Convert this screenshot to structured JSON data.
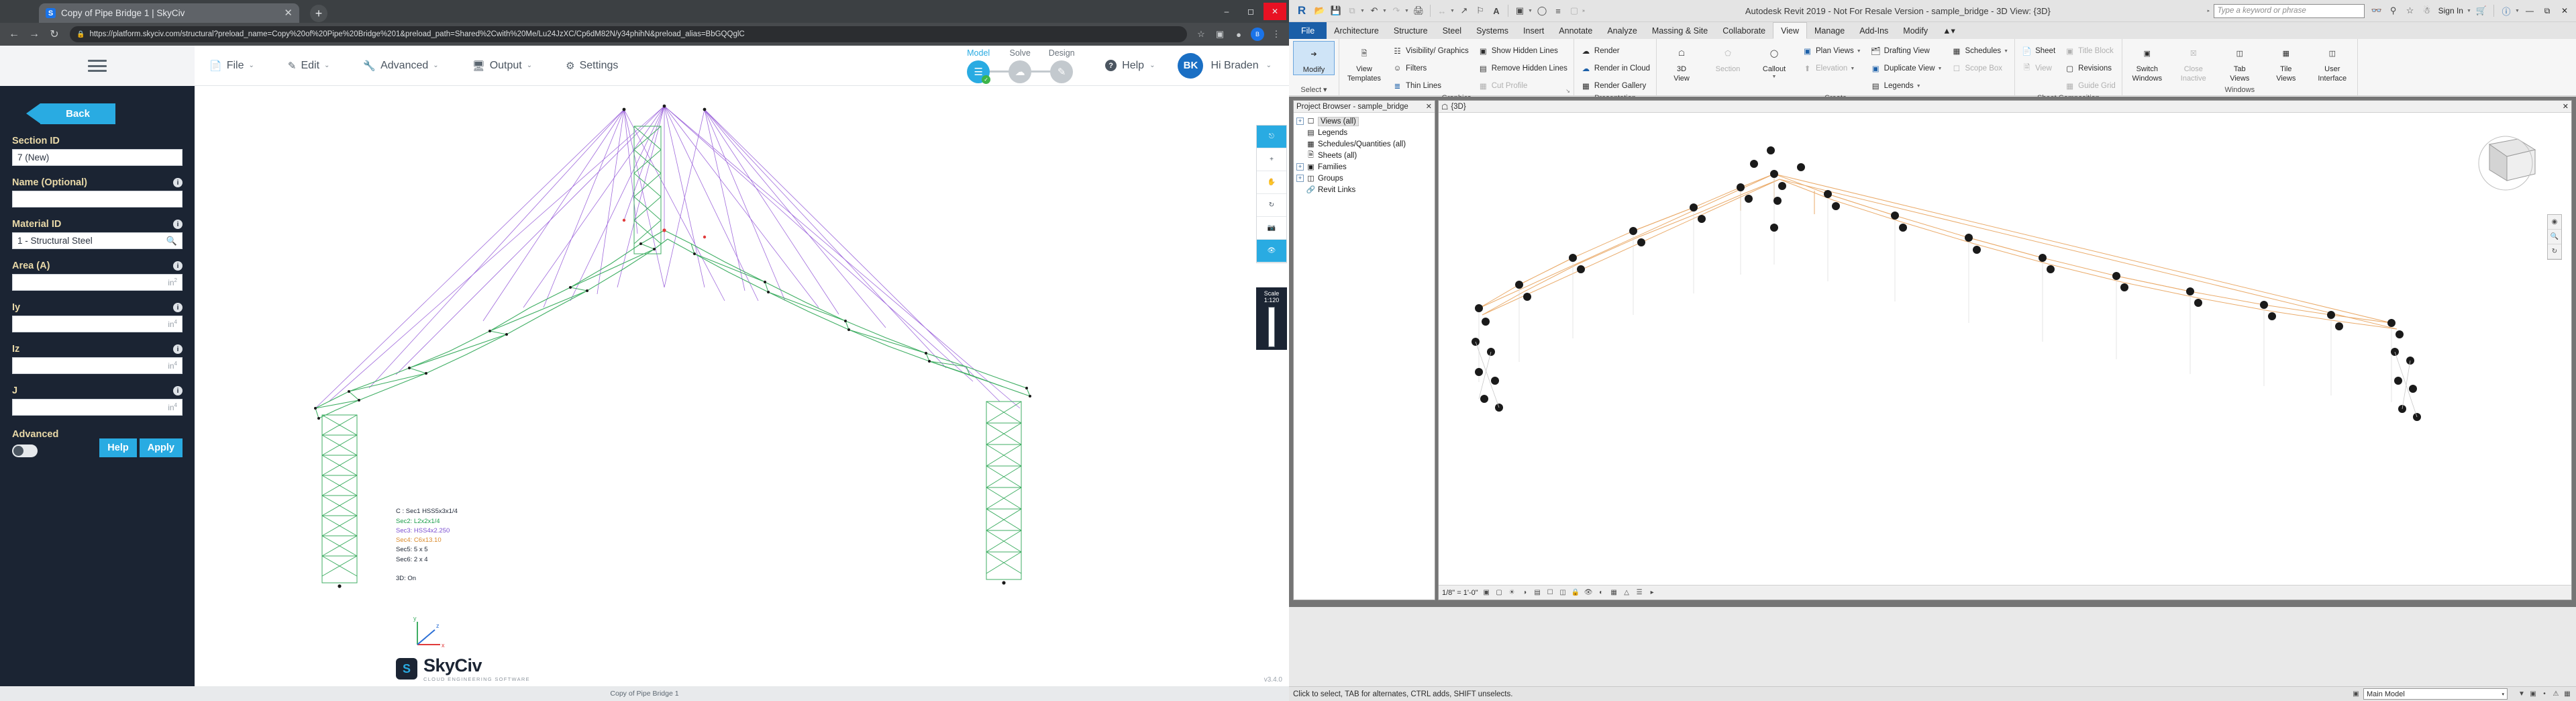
{
  "browser": {
    "tab": {
      "title": "Copy of Pipe Bridge 1 | SkyCiv",
      "favicon_letter": "S",
      "close": "✕"
    },
    "newtab_label": "+",
    "url": "https://platform.skyciv.com/structural?preload_name=Copy%20of%20Pipe%20Bridge%201&preload_path=Shared%2Cwith%20Me/Lu24JzXC/Cp6dM82N/y34phihN&preload_alias=BbGQQglC",
    "lock_icon": "lock-icon",
    "window_buttons": [
      "–",
      "❐",
      "✕"
    ]
  },
  "skyciv": {
    "menu": [
      {
        "label": "File",
        "icon": "file-icon",
        "caret": "⌄"
      },
      {
        "label": "Edit",
        "icon": "pencil-icon",
        "caret": "⌄"
      },
      {
        "label": "Advanced",
        "icon": "wrench-icon",
        "caret": "⌄"
      },
      {
        "label": "Output",
        "icon": "monitor-icon",
        "caret": "⌄"
      },
      {
        "label": "Settings",
        "icon": "gear-icon",
        "caret": ""
      }
    ],
    "stages": [
      {
        "label": "Model",
        "active": true,
        "check": "✓"
      },
      {
        "label": "Solve",
        "active": false
      },
      {
        "label": "Design",
        "active": false
      }
    ],
    "help": {
      "label": "Help",
      "caret": "⌄",
      "icon": "question-icon"
    },
    "user": {
      "initials": "BK",
      "greeting": "Hi Braden",
      "caret": "⌄"
    },
    "sidebar": {
      "back_label": "Back",
      "fields": [
        {
          "label": "Section ID",
          "value": "7 (New)",
          "unit": "",
          "info": false
        },
        {
          "label": "Name (Optional)",
          "value": "",
          "unit": "",
          "info": true
        },
        {
          "label": "Material ID",
          "value": "1 - Structural Steel",
          "unit": "",
          "info": true,
          "search": true
        },
        {
          "label": "Area (A)",
          "value": "",
          "unit": "in",
          "exp": "2",
          "info": true
        },
        {
          "label": "Iy",
          "value": "",
          "unit": "in",
          "exp": "4",
          "info": true
        },
        {
          "label": "Iz",
          "value": "",
          "unit": "in",
          "exp": "4",
          "info": true
        },
        {
          "label": "J",
          "value": "",
          "unit": "in",
          "exp": "4",
          "info": true
        }
      ],
      "advanced_label": "Advanced",
      "help_label": "Help",
      "apply_label": "Apply"
    },
    "legend": [
      {
        "text": "C   : Sec1 HSS5x3x1/4",
        "color": "#1b2433"
      },
      {
        "text": "Sec2: L2x2x1/4",
        "color": "#1b9e4a"
      },
      {
        "text": "Sec3: HSS4x2.250",
        "color": "#7b4fd1"
      },
      {
        "text": "Sec4: C6x13.10",
        "color": "#d98a2b"
      },
      {
        "text": "Sec5: 5 x 5",
        "color": "#1b2433"
      },
      {
        "text": "Sec6: 2 x 4",
        "color": "#1b2433"
      }
    ],
    "legend_footer": "3D: On",
    "axis_labels": {
      "x": "x",
      "y": "y",
      "z": "z"
    },
    "logo": {
      "name": "SkyCiv",
      "tagline": "CLOUD ENGINEERING SOFTWARE",
      "mark": "S"
    },
    "footer_status": "Copy of Pipe Bridge 1",
    "version": "v3.4.0",
    "float_tools": [
      "pan-icon",
      "orbit-icon",
      "pan-label",
      "rotate-label",
      "camera-icon",
      "eye-icon"
    ],
    "float_tool_labels": [
      "Pan",
      "Zoom",
      "Rotate",
      "Camera",
      "Select"
    ],
    "scale_label": "Scale 1:120"
  },
  "revit": {
    "title": "Autodesk Revit 2019 - Not For Resale Version - sample_bridge - 3D View: {3D}",
    "logo": "R",
    "qat_icons": [
      "open-icon",
      "save-icon",
      "save-as-icon",
      "undo-icon",
      "redo-icon",
      "print-icon",
      "measure-icon",
      "aligned-dimension-icon",
      "tag-icon",
      "text-icon",
      "default-3d-view-icon",
      "section-icon",
      "thin-lines-icon",
      "close-hidden-icon"
    ],
    "search_placeholder": "Type a keyword or phrase",
    "sign_in": "Sign In",
    "help_icon": "question-circle-icon",
    "tabs": [
      "File",
      "Architecture",
      "Structure",
      "Steel",
      "Systems",
      "Insert",
      "Annotate",
      "Analyze",
      "Massing & Site",
      "Collaborate",
      "View",
      "Manage",
      "Add-Ins",
      "Modify"
    ],
    "active_tab": "View",
    "ribbon": {
      "select_panel": {
        "title": "Select ▾",
        "button": "Modify",
        "icon": "cursor-icon"
      },
      "graphics_panel": {
        "title": "Graphics",
        "big": {
          "label1": "View",
          "label2": "Templates",
          "icon": "view-templates-icon"
        },
        "items": [
          {
            "label": "Visibility/ Graphics",
            "icon": "visibility-graphics-icon",
            "disabled": false
          },
          {
            "label": "Filters",
            "icon": "filters-icon",
            "disabled": false
          },
          {
            "label": "Thin Lines",
            "icon": "thin-lines-icon",
            "disabled": false
          },
          {
            "label": "Show Hidden Lines",
            "icon": "show-hidden-lines-icon",
            "disabled": false
          },
          {
            "label": "Remove Hidden Lines",
            "icon": "remove-hidden-lines-icon",
            "disabled": false
          },
          {
            "label": "Cut Profile",
            "icon": "cut-profile-icon",
            "disabled": true
          }
        ]
      },
      "presentation_panel": {
        "title": "Presentation",
        "items": [
          {
            "label": "Render",
            "icon": "render-icon"
          },
          {
            "label": "Render in Cloud",
            "icon": "render-cloud-icon"
          },
          {
            "label": "Render Gallery",
            "icon": "render-gallery-icon"
          }
        ]
      },
      "create_panel": {
        "title": "Create",
        "big": [
          {
            "label1": "3D",
            "label2": "View",
            "icon": "3d-view-icon",
            "caret": true
          },
          {
            "label1": "Section",
            "label2": "",
            "icon": "section-icon",
            "disabled": true
          },
          {
            "label1": "Callout",
            "label2": "",
            "icon": "callout-icon",
            "caret": true
          }
        ],
        "items": [
          {
            "label": "Plan Views",
            "icon": "plan-views-icon",
            "caret": true
          },
          {
            "label": "Elevation",
            "icon": "elevation-icon",
            "caret": true,
            "disabled": true
          },
          {
            "label": "Drafting View",
            "icon": "drafting-view-icon"
          },
          {
            "label": "Duplicate View",
            "icon": "duplicate-view-icon",
            "caret": true
          },
          {
            "label": "Legends",
            "icon": "legends-icon",
            "caret": true
          },
          {
            "label": "Schedules",
            "icon": "schedules-icon",
            "caret": true
          },
          {
            "label": "Scope Box",
            "icon": "scope-box-icon",
            "disabled": true
          }
        ]
      },
      "sheet_panel": {
        "title": "Sheet Composition",
        "items": [
          {
            "label": "Sheet",
            "icon": "sheet-icon"
          },
          {
            "label": "View",
            "icon": "view-icon",
            "disabled": true
          },
          {
            "label": "Title Block",
            "icon": "title-block-icon",
            "disabled": true
          },
          {
            "label": "Revisions",
            "icon": "revisions-icon"
          },
          {
            "label": "Guide Grid",
            "icon": "guide-grid-icon",
            "disabled": true
          }
        ]
      },
      "windows_panel": {
        "title": "Windows",
        "items": [
          {
            "label1": "Switch",
            "label2": "Windows",
            "icon": "switch-windows-icon"
          },
          {
            "label1": "Close",
            "label2": "Inactive",
            "icon": "close-inactive-icon",
            "disabled": true
          },
          {
            "label1": "Tab",
            "label2": "Views",
            "icon": "tab-views-icon"
          },
          {
            "label1": "Tile",
            "label2": "Views",
            "icon": "tile-views-icon"
          },
          {
            "label1": "User",
            "label2": "Interface",
            "icon": "user-interface-icon",
            "caret": true
          }
        ]
      }
    },
    "project_browser": {
      "title": "Project Browser - sample_bridge",
      "close": "✕",
      "nodes": [
        {
          "label": "Views (all)",
          "expand": "+",
          "icon": "views-icon",
          "selected": true
        },
        {
          "label": "Legends",
          "expand": "",
          "icon": "legends-icon"
        },
        {
          "label": "Schedules/Quantities (all)",
          "expand": "",
          "icon": "schedules-icon"
        },
        {
          "label": "Sheets (all)",
          "expand": "",
          "icon": "sheets-icon"
        },
        {
          "label": "Families",
          "expand": "+",
          "icon": "families-icon"
        },
        {
          "label": "Groups",
          "expand": "+",
          "icon": "groups-icon"
        },
        {
          "label": "Revit Links",
          "expand": "",
          "icon": "revit-links-icon"
        }
      ]
    },
    "view_window": {
      "title": "{3D}",
      "icon": "3d-view-icon",
      "close": "✕"
    },
    "view_bottom": {
      "scale": "1/8\" = 1'-0\"",
      "icons": [
        "detail-level-icon",
        "visual-style-icon",
        "sun-path-icon",
        "shadows-icon",
        "render-dialog-icon",
        "crop-view-icon",
        "crop-region-icon",
        "lock-3d-icon",
        "temp-hide-icon",
        "reveal-hidden-icon",
        "temp-view-icon",
        "analytical-model-icon",
        "constraints-icon",
        "chevron-right-icon"
      ]
    },
    "status_bar": {
      "hint": "Click to select, TAB for alternates, CTRL adds, SHIFT unselects.",
      "model_selector": "Main Model",
      "selector_caret": "▾",
      "right_icons": [
        "filter-icon",
        "exclude-options-icon",
        "press-drag-icon",
        "count-icon",
        "warnings-icon"
      ]
    }
  }
}
